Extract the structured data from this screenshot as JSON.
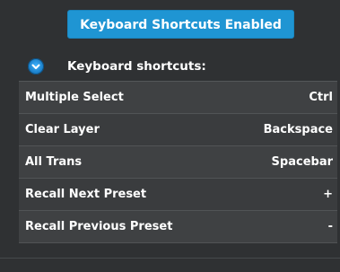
{
  "toggle_button": {
    "label": "Keyboard Shortcuts Enabled"
  },
  "section": {
    "title": "Keyboard shortcuts:",
    "expander_icon": "chevron-down-icon"
  },
  "shortcuts": [
    {
      "action": "Multiple Select",
      "key": "Ctrl"
    },
    {
      "action": "Clear Layer",
      "key": "Backspace"
    },
    {
      "action": "All Trans",
      "key": "Spacebar"
    },
    {
      "action": "Recall Next Preset",
      "key": "+"
    },
    {
      "action": "Recall Previous Preset",
      "key": "-"
    }
  ],
  "colors": {
    "panel_background": "#2f3133",
    "accent": "#1f95d3",
    "row_background": "#3f4143",
    "text": "#ffffff"
  }
}
